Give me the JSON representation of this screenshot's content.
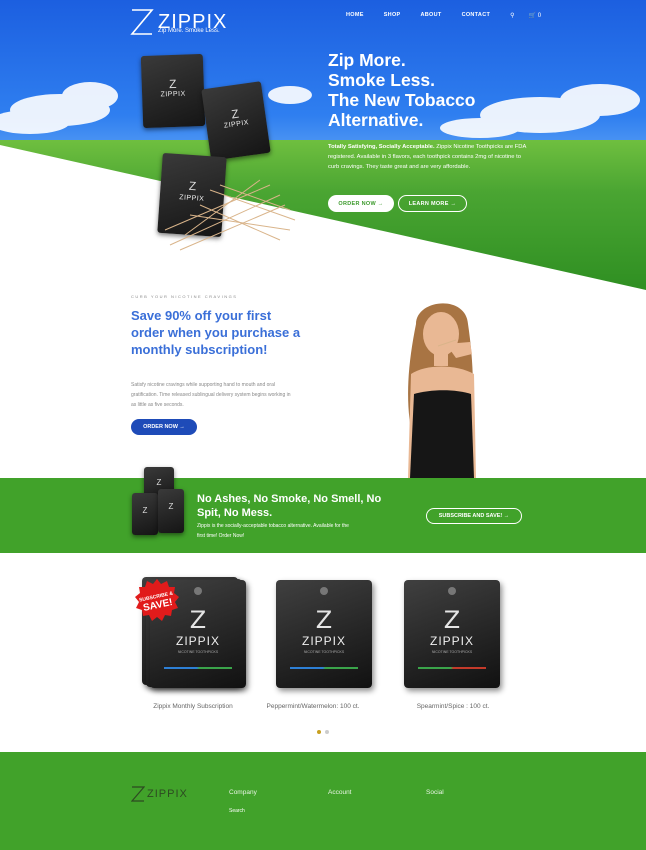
{
  "header": {
    "brand": "ZIPPIX",
    "tagline": "Zip More. Smoke Less.",
    "nav": [
      "HOME",
      "SHOP",
      "ABOUT",
      "CONTACT"
    ],
    "cart_count": "0"
  },
  "hero": {
    "title_lines": [
      "Zip More.",
      "Smoke Less.",
      "The New Tobacco",
      "Alternative."
    ],
    "text_bold": "Totally Satisfying, Socially Acceptable.",
    "text_rest": " Zippix Nicotine Toothpicks are FDA registered. Available in 3 flavors, each toothpick contains 2mg of nicotine to curb cravings. They taste great and are very affordable.",
    "order_button": "ORDER NOW →",
    "learn_button": "LEARN MORE →",
    "pack_brand": "ZIPPIX"
  },
  "promo": {
    "eyebrow": "CURB YOUR NICOTINE CRAVINGS",
    "title": "Save 90% off your first order when you purchase a monthly subscription!",
    "text": "Satisfy nicotine cravings while supporting hand to mouth and oral gratification. Time released sublingual delivery system begins working in as little as five seconds.",
    "order_button": "ORDER NOW →"
  },
  "band": {
    "title": "No Ashes, No Smoke, No Smell, No Spit, No Mess.",
    "text": "Zippix is the socially-acceptable tobacco alternative. Available for the first time! Order Now!",
    "subscribe_button": "SUBSCRIBE AND SAVE! →"
  },
  "products": {
    "badge_line1": "SUBSCRIBE &",
    "badge_line2": "SAVE!",
    "pack_brand": "ZIPPIX",
    "pack_sub": "NICOTINE TOOTHPICKS",
    "items": [
      {
        "name": "Zippix Monthly Subscription"
      },
      {
        "name": "Peppermint/Watermelon: 100 ct."
      },
      {
        "name": "Spearmint/Spice : 100 ct."
      }
    ]
  },
  "footer": {
    "brand": "ZIPPIX",
    "columns": [
      "Company",
      "Account",
      "Social"
    ],
    "company_links": [
      "Search"
    ]
  },
  "colors": {
    "green": "#41a22a",
    "blue_title": "#3a6fd8",
    "blue_button": "#1e4bb8",
    "sky": "#2f7ff0"
  },
  "icons": [
    "search-icon",
    "cart-icon",
    "zippix-logo-icon"
  ]
}
